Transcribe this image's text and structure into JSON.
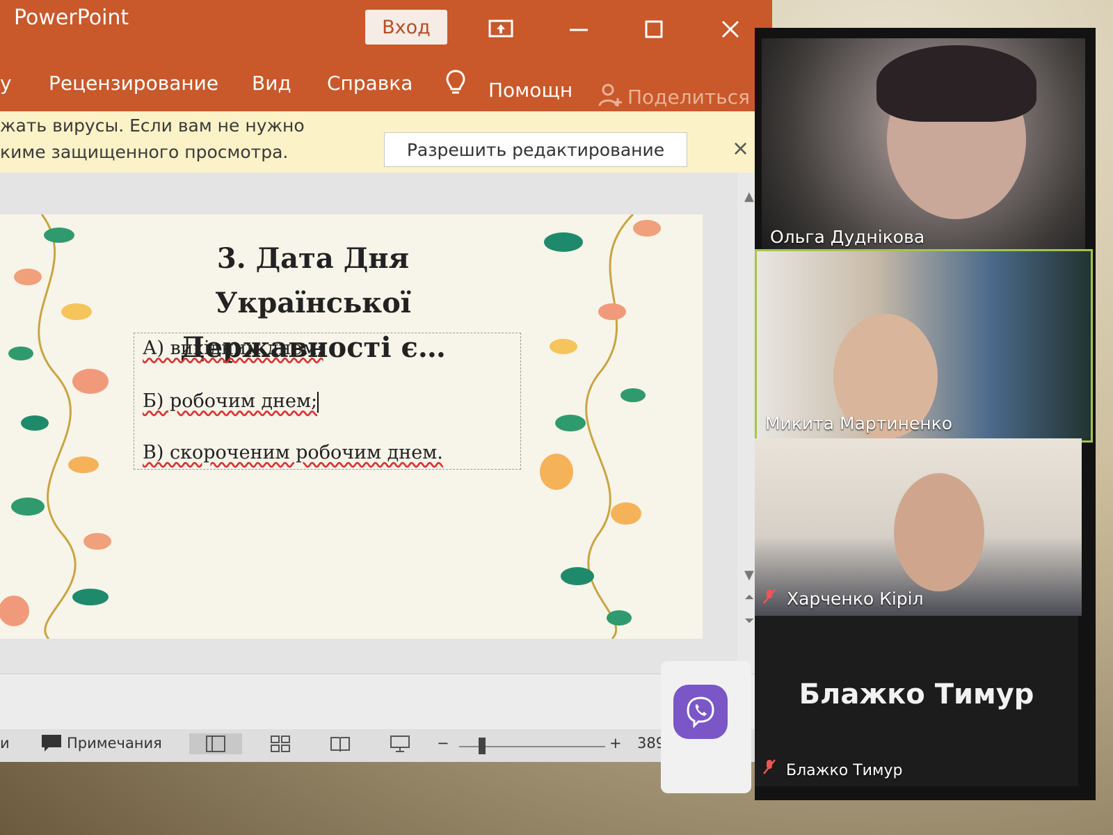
{
  "app": {
    "name": "PowerPoint",
    "signin_label": "Вход"
  },
  "ribbon": {
    "tabs": [
      "y",
      "Рецензирование",
      "Вид",
      "Справка"
    ],
    "tell_me": "Помощн",
    "share": "Поделиться"
  },
  "message_bar": {
    "line1": "жать вирусы. Если вам не нужно",
    "line2": "киме защищенного просмотра.",
    "enable_button": "Разрешить редактирование",
    "close_glyph": "×"
  },
  "slide": {
    "title_line1": "3. Дата Дня Української",
    "title_line2": "Державності є…",
    "answers": [
      "А) вихідним днем;",
      "Б) робочим днем;",
      "В) скороченим робочим днем."
    ]
  },
  "status_bar": {
    "left_fragment": "и",
    "notes_label": "Примечания",
    "zoom_minus": "−",
    "zoom_plus": "+",
    "zoom_value": "389"
  },
  "call": {
    "participants": [
      {
        "name": "Ольга Дуднікова",
        "muted": false
      },
      {
        "name": "Микита Мартиненко",
        "muted": false
      },
      {
        "name": "Харченко Кіріл",
        "muted": true
      },
      {
        "name": "Блажко Тимур",
        "muted": true
      }
    ],
    "big_name": "Блажко Тимур"
  },
  "icons": {
    "present": "present-icon",
    "minimize": "minimize-icon",
    "maximize": "maximize-icon",
    "close": "close-icon",
    "lightbulb": "lightbulb-icon",
    "share_person": "person-add-icon",
    "notes": "comment-icon",
    "mic_off": "mic-off-icon",
    "viber": "viber-icon"
  },
  "colors": {
    "ppt_orange": "#c9582a",
    "message_bar": "#fbf2c7",
    "active_speaker_border": "#a6c447",
    "viber_purple": "#7b56c7"
  }
}
